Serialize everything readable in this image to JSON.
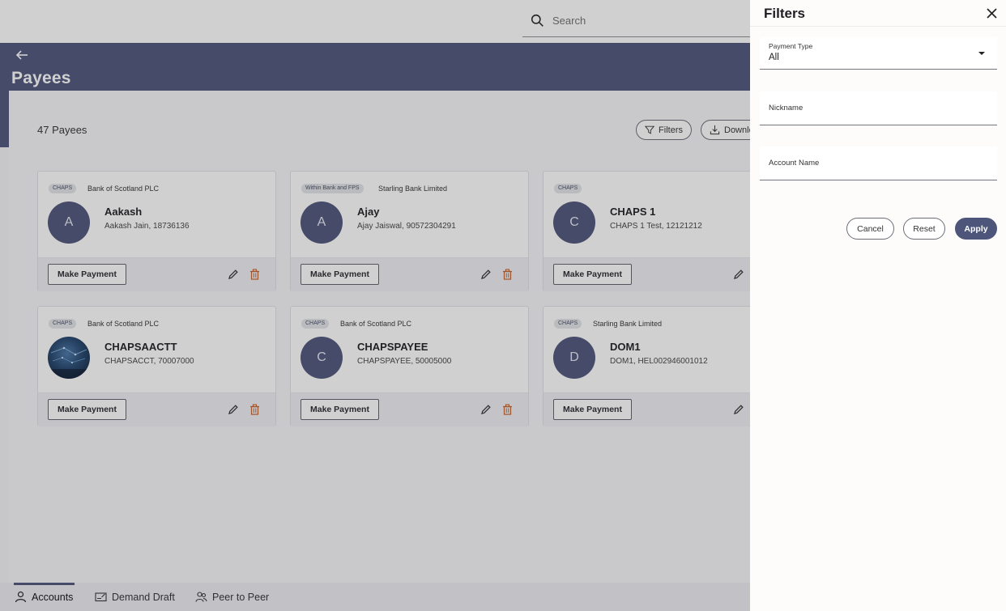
{
  "search": {
    "placeholder": "Search"
  },
  "header": {
    "title": "Payees"
  },
  "summary": {
    "count": "47 Payees",
    "filters_label": "Filters",
    "download_label": "Downlo"
  },
  "cards": [
    {
      "tag": "CHAPS",
      "bank": "Bank of Scotland PLC",
      "initial": "A",
      "name": "Aakash",
      "detail": "Aakash Jain, 18736136",
      "action": "Make Payment"
    },
    {
      "tag": "Within Bank and FPS",
      "bank": "Starling Bank Limited",
      "initial": "A",
      "name": "Ajay",
      "detail": "Ajay Jaiswal, 90572304291",
      "action": "Make Payment"
    },
    {
      "tag": "CHAPS",
      "bank": "",
      "initial": "C",
      "name": "CHAPS 1",
      "detail": "CHAPS 1 Test, 12121212",
      "action": "Make Payment"
    },
    {
      "tag": "CHAPS",
      "bank": "Bank of Scotland PLC",
      "initial": "",
      "name": "CHAPSAACTT",
      "detail": "CHAPSACCT, 70007000",
      "action": "Make Payment"
    },
    {
      "tag": "CHAPS",
      "bank": "Bank of Scotland PLC",
      "initial": "C",
      "name": "CHAPSPAYEE",
      "detail": "CHAPSPAYEE, 50005000",
      "action": "Make Payment"
    },
    {
      "tag": "CHAPS",
      "bank": "Starling Bank Limited",
      "initial": "D",
      "name": "DOM1",
      "detail": "DOM1, HEL002946001012",
      "action": "Make Payment"
    }
  ],
  "bottom_nav": [
    {
      "label": "Accounts",
      "icon": "person-icon",
      "active": true
    },
    {
      "label": "Demand Draft",
      "icon": "draft-icon",
      "active": false
    },
    {
      "label": "Peer to Peer",
      "icon": "people-icon",
      "active": false
    }
  ],
  "filters": {
    "title": "Filters",
    "payment_type_label": "Payment Type",
    "payment_type_value": "All",
    "nickname_label": "Nickname",
    "account_name_label": "Account Name",
    "cancel_label": "Cancel",
    "reset_label": "Reset",
    "apply_label": "Apply"
  },
  "colors": {
    "accent": "#4e557a",
    "delete": "#c0602a"
  }
}
